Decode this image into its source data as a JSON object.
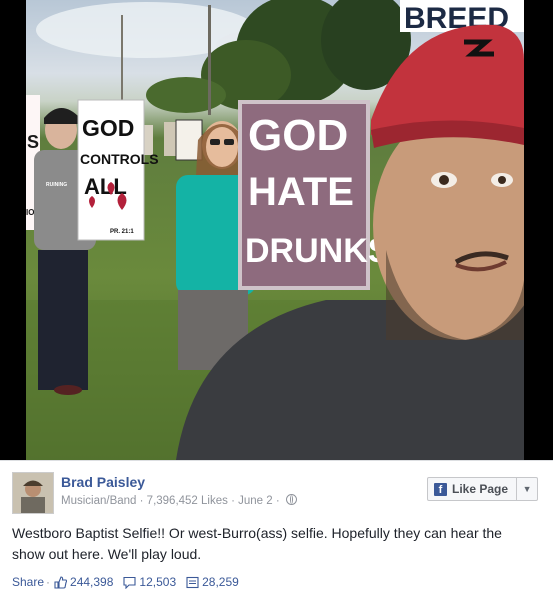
{
  "photo": {
    "signs": {
      "top_right": "BREED",
      "left_partial": "S",
      "left_partial_2": "IO",
      "god_controls": [
        "GOD",
        "CONTROLS",
        "ALL"
      ],
      "god_controls_small": "RUINING",
      "god_controls_ref": "PR. 21:1",
      "god_hates": [
        "GOD",
        "HATE",
        "DRUNKS"
      ]
    }
  },
  "post": {
    "author": "Brad Paisley",
    "category": "Musician/Band",
    "likes_count": "7,396,452 Likes",
    "date": "June 2",
    "like_page_label": "Like Page",
    "caption": "Westboro Baptist Selfie!! Or west-Burro(ass) selfie. Hopefully they can hear the show out here. We'll play loud.",
    "share_label": "Share",
    "likes": "244,398",
    "comments": "12,503",
    "shares": "28,259"
  },
  "colors": {
    "link": "#3b5998",
    "muted": "#90949c",
    "text": "#1d2129"
  }
}
